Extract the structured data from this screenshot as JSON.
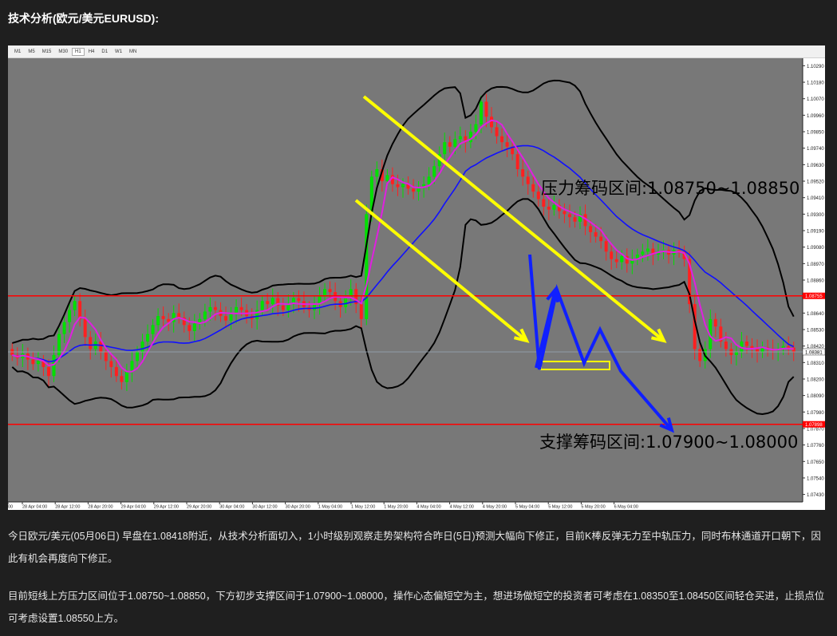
{
  "page": {
    "title": "技术分析(欧元/美元EURUSD):",
    "paragraphs": [
      "今日欧元/美元(05月06日) 早盘在1.08418附近，从技术分析面切入，1小时级别观察走势架构符合昨日(5日)预测大幅向下修正，目前K棒反弹无力至中轨压力，同时布林通道开口朝下，因此有机会再度向下修正。",
      "目前短线上方压力区间位于1.08750~1.08850，下方初步支撑区间于1.07900~1.08000，操作心态偏短空为主，想进场做短空的投资者可考虑在1.08350至1.08450区间轻仓买进，止损点位可考虑设置1.08550上方。"
    ]
  },
  "toolbar": {
    "timeframes": [
      "M1",
      "M5",
      "M15",
      "M30",
      "H1",
      "H4",
      "D1",
      "W1",
      "MN"
    ],
    "active_index": 4
  },
  "chart_data": {
    "type": "candlestick",
    "symbol": "EURUSD",
    "timeframe": "H1",
    "y_ticks": [
      "1.10290",
      "1.10180",
      "1.10070",
      "1.09960",
      "1.09850",
      "1.09740",
      "1.09630",
      "1.09520",
      "1.09410",
      "1.09300",
      "1.09190",
      "1.09080",
      "1.08970",
      "1.08860",
      "1.08750",
      "1.08640",
      "1.08530",
      "1.08420",
      "1.08310",
      "1.08200",
      "1.08090",
      "1.07980",
      "1.07870",
      "1.07760",
      "1.07650",
      "1.07540",
      "1.07430"
    ],
    "ylim": [
      1.0738,
      1.1034
    ],
    "x_ticks": [
      "00",
      "28 Apr 04:00",
      "28 Apr 12:00",
      "28 Apr 20:00",
      "29 Apr 04:00",
      "29 Apr 12:00",
      "29 Apr 20:00",
      "30 Apr 04:00",
      "30 Apr 12:00",
      "30 Apr 20:00",
      "1 May 04:00",
      "1 May 12:00",
      "1 May 20:00",
      "4 May 04:00",
      "4 May 12:00",
      "4 May 20:00",
      "5 May 04:00",
      "5 May 12:00",
      "5 May 20:00",
      "6 May 04:00"
    ],
    "current_price": "1.08381",
    "resistance_line_price": 1.08755,
    "resistance_line_label": "1.08755",
    "support_line_price": 1.07898,
    "support_line_label": "1.07898",
    "annotations": {
      "resistance": "压力筹码区间:1.08750~1.08850",
      "support": "支撑筹码区间:1.07900~1.08000"
    },
    "closes": [
      1.0836,
      1.0834,
      1.0837,
      1.0833,
      1.083,
      1.0832,
      1.0828,
      1.0822,
      1.0836,
      1.085,
      1.0858,
      1.0866,
      1.0872,
      1.086,
      1.0848,
      1.084,
      1.0845,
      1.0838,
      1.0832,
      1.0828,
      1.0822,
      1.0818,
      1.0825,
      1.0832,
      1.0838,
      1.0845,
      1.085,
      1.0856,
      1.0862,
      1.086,
      1.0858,
      1.0864,
      1.0861,
      1.0856,
      1.0852,
      1.0857,
      1.086,
      1.0865,
      1.0868,
      1.0866,
      1.0862,
      1.0859,
      1.0864,
      1.0868,
      1.0866,
      1.0862,
      1.086,
      1.0866,
      1.0872,
      1.087,
      1.0874,
      1.0869,
      1.0866,
      1.087,
      1.0874,
      1.0872,
      1.0868,
      1.0866,
      1.087,
      1.0875,
      1.088,
      1.0878,
      1.0872,
      1.0868,
      1.0874,
      1.088,
      1.087,
      1.086,
      1.093,
      1.0955,
      1.096,
      1.0952,
      1.0956,
      1.095,
      1.0948,
      1.095,
      1.0947,
      1.0945,
      1.0948,
      1.095,
      1.0955,
      1.0962,
      1.097,
      1.0978,
      1.0975,
      1.098,
      1.0982,
      1.0978,
      1.0985,
      1.099,
      1.1005,
      1.0995,
      1.0988,
      1.0982,
      1.0978,
      1.0975,
      1.097,
      1.096,
      1.0955,
      1.095,
      1.0945,
      1.094,
      1.0935,
      1.0933,
      1.0936,
      1.0932,
      1.093,
      1.0928,
      1.0925,
      1.093,
      1.0922,
      1.0918,
      1.0915,
      1.0912,
      1.0905,
      1.09,
      1.0898,
      1.0902,
      1.0897,
      1.09,
      1.0903,
      1.0905,
      1.0907,
      1.0903,
      1.0905,
      1.0906,
      1.0903,
      1.0906,
      1.0905,
      1.09,
      1.087,
      1.084,
      1.0832,
      1.084,
      1.086,
      1.0855,
      1.0845,
      1.084,
      1.0836,
      1.0838,
      1.0845,
      1.0842,
      1.084,
      1.0838,
      1.0841,
      1.084,
      1.0839,
      1.084,
      1.0842,
      1.0841,
      1.0838
    ]
  },
  "colors": {
    "chart_bg": "#787878",
    "bull": "#00e000",
    "bear": "#ff2020",
    "mid_line": "#1010ff",
    "ma_line": "#e020e0",
    "band_line": "#000000",
    "level_line": "#ff0000",
    "arrow_yellow": "#ffff00",
    "arrow_blue": "#1020ff"
  }
}
